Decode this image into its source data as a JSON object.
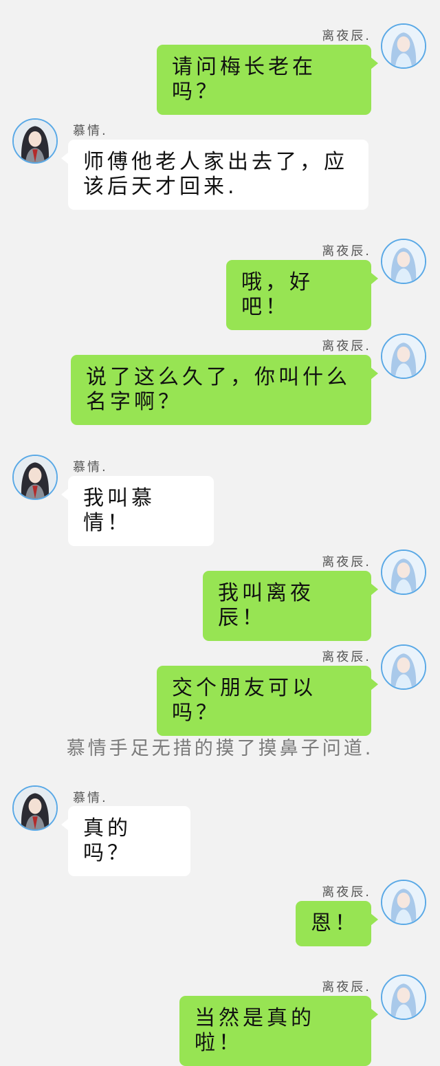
{
  "chat": {
    "names": {
      "lye": "离夜辰.",
      "mq": "慕情."
    },
    "messages": [
      {
        "sender": "离夜辰.",
        "side": "right",
        "avatar": "girl-avatar-icon",
        "text": "请问梅长老在吗？"
      },
      {
        "sender": "慕情.",
        "side": "left",
        "avatar": "boy-avatar-icon",
        "text": "师傅他老人家出去了，应该后天才回来."
      },
      {
        "sender": "离夜辰.",
        "side": "right",
        "avatar": "girl-avatar-icon",
        "text": "哦，好吧！"
      },
      {
        "sender": "离夜辰.",
        "side": "right",
        "avatar": "girl-avatar-icon",
        "text": "说了这么久了，你叫什么名字啊？"
      },
      {
        "sender": "慕情.",
        "side": "left",
        "avatar": "boy-avatar-icon",
        "text": "我叫慕情！"
      },
      {
        "sender": "离夜辰.",
        "side": "right",
        "avatar": "girl-avatar-icon",
        "text": "我叫离夜辰！"
      },
      {
        "sender": "离夜辰.",
        "side": "right",
        "avatar": "girl-avatar-icon",
        "text": "交个朋友可以吗？"
      },
      {
        "sender": "慕情.",
        "side": "left",
        "avatar": "boy-avatar-icon",
        "text": "真的吗？"
      },
      {
        "sender": "离夜辰.",
        "side": "right",
        "avatar": "girl-avatar-icon",
        "text": "恩！"
      },
      {
        "sender": "离夜辰.",
        "side": "right",
        "avatar": "girl-avatar-icon",
        "text": "当然是真的啦！"
      }
    ],
    "narration": "慕情手足无措的摸了摸鼻子问道."
  },
  "colors": {
    "background": "#f2f2f2",
    "right_bubble": "#97e453",
    "left_bubble": "#ffffff",
    "avatar_border": "#5aa9e6"
  }
}
